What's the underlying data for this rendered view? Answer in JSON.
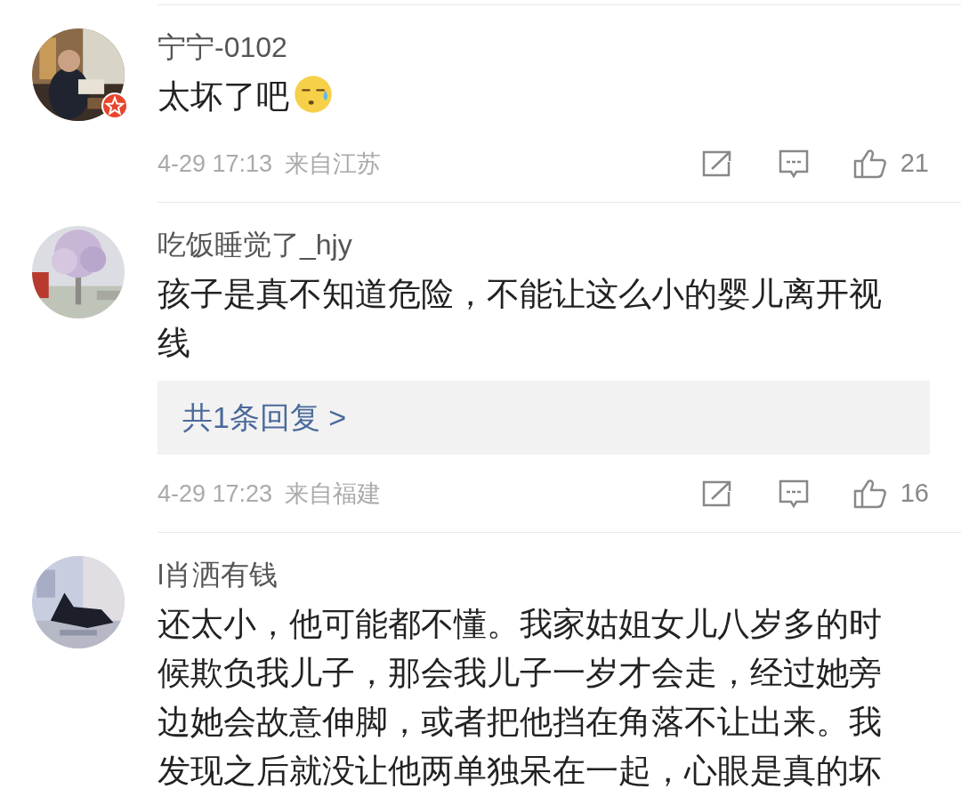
{
  "comments": [
    {
      "name": "宁宁-0102",
      "verified": true,
      "text": "太坏了吧",
      "emoji": {
        "kind": "sweat"
      },
      "date": "4-29 17:13",
      "location": "来自江苏",
      "likes": "21"
    },
    {
      "name": "吃饭睡觉了_hjy",
      "verified": false,
      "text": "孩子是真不知道危险，不能让这么小的婴儿离开视线",
      "reply_link": "共1条回复 >",
      "date": "4-29 17:23",
      "location": "来自福建",
      "likes": "16"
    },
    {
      "name": "l肖洒有钱",
      "verified": false,
      "text": "还太小，他可能都不懂。我家姑姐女儿八岁多的时候欺负我儿子，那会我儿子一岁才会走，经过她旁边她会故意伸脚，或者把他挡在角落不让出来。我发现之后就没让他两单独呆在一起，心眼是真的坏"
    }
  ]
}
